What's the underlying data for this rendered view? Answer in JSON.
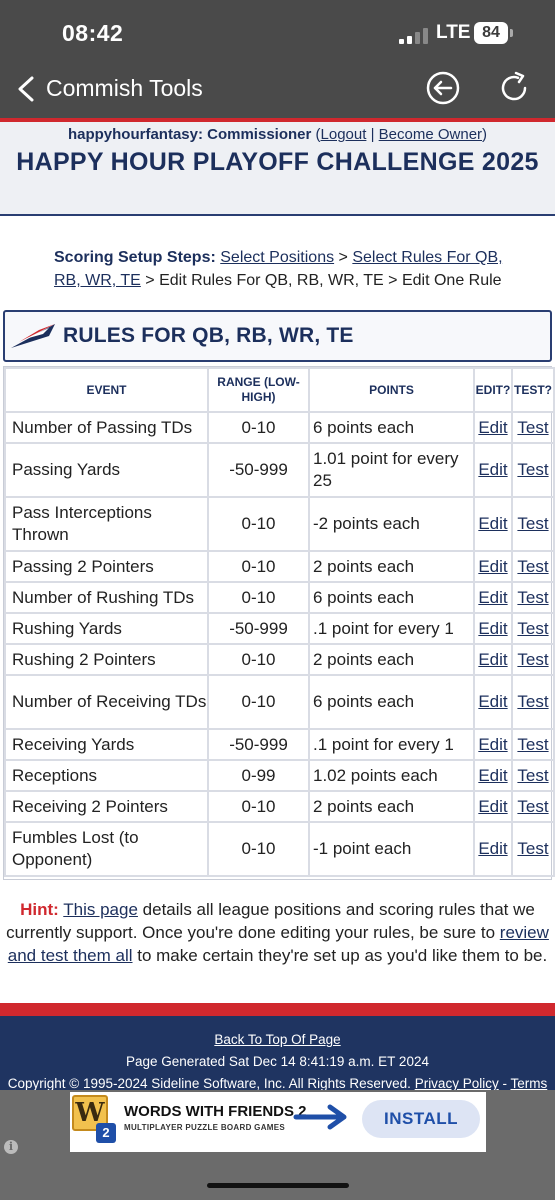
{
  "status_bar": {
    "time": "08:42",
    "network": "LTE",
    "battery": "84"
  },
  "nav": {
    "title": "Commish Tools",
    "back_icon": "chevron-left-icon",
    "back_button_icon": "circle-arrow-left-icon",
    "refresh_icon": "refresh-icon"
  },
  "header": {
    "user": "happyhourfantasy: Commissioner",
    "logout": "Logout",
    "separator": "|",
    "become_owner": "Become Owner",
    "league_title": "HAPPY HOUR PLAYOFF CHALLENGE 2025"
  },
  "steps": {
    "label": "Scoring Setup Steps:",
    "step1": "Select Positions",
    "sep": ">",
    "step2": "Select Rules For QB, RB, WR, TE",
    "step3": "Edit Rules For QB, RB, WR, TE",
    "step4": "Edit One Rule"
  },
  "section": {
    "title": "RULES FOR QB, RB, WR, TE"
  },
  "table": {
    "headers": {
      "event": "EVENT",
      "range": "RANGE (LOW-HIGH)",
      "points": "POINTS",
      "edit": "EDIT?",
      "test": "TEST?"
    },
    "rows": [
      {
        "event": "Number of Passing TDs",
        "range": "0-10",
        "points": "6 points each",
        "edit": "Edit",
        "test": "Test"
      },
      {
        "event": "Passing Yards",
        "range": "-50-999",
        "points": "1.01 point for every 25",
        "edit": "Edit",
        "test": "Test"
      },
      {
        "event": "Pass Interceptions Thrown",
        "range": "0-10",
        "points": "-2 points each",
        "edit": "Edit",
        "test": "Test"
      },
      {
        "event": "Passing 2 Pointers",
        "range": "0-10",
        "points": "2 points each",
        "edit": "Edit",
        "test": "Test"
      },
      {
        "event": "Number of Rushing TDs",
        "range": "0-10",
        "points": "6 points each",
        "edit": "Edit",
        "test": "Test"
      },
      {
        "event": "Rushing Yards",
        "range": "-50-999",
        "points": ".1 point for every 1",
        "edit": "Edit",
        "test": "Test"
      },
      {
        "event": "Rushing 2 Pointers",
        "range": "0-10",
        "points": "2 points each",
        "edit": "Edit",
        "test": "Test"
      },
      {
        "event": "Number of Receiving TDs",
        "range": "0-10",
        "points": "6 points each",
        "edit": "Edit",
        "test": "Test"
      },
      {
        "event": "Receiving Yards",
        "range": "-50-999",
        "points": ".1 point for every 1",
        "edit": "Edit",
        "test": "Test"
      },
      {
        "event": "Receptions",
        "range": "0-99",
        "points": "1.02 points each",
        "edit": "Edit",
        "test": "Test"
      },
      {
        "event": "Receiving 2 Pointers",
        "range": "0-10",
        "points": "2 points each",
        "edit": "Edit",
        "test": "Test"
      },
      {
        "event": "Fumbles Lost (to Opponent)",
        "range": "0-10",
        "points": "-1 point each",
        "edit": "Edit",
        "test": "Test"
      }
    ]
  },
  "hint": {
    "label": "Hint:",
    "link1": "This page",
    "text1": "details all league positions and scoring rules that we currently support. Once you're done editing your rules, be sure to",
    "link2": "review and test them all",
    "text2": "to make certain they're set up as you'd like them to be."
  },
  "footer": {
    "back_to_top": "Back To Top Of Page",
    "generated": "Page Generated Sat Dec 14 8:41:19 a.m. ET 2024",
    "copyright": "Copyright © 1995-2024 Sideline Software, Inc. All Rights Reserved.",
    "privacy": "Privacy Policy",
    "dash": "-",
    "terms": "Terms"
  },
  "ad": {
    "logo_letter": "W",
    "logo_num": "2",
    "name": "WORDS WITH FRIENDS 2",
    "subtitle": "MULTIPLAYER PUZZLE BOARD GAMES",
    "install": "INSTALL",
    "info": "i"
  },
  "colors": {
    "navy": "#1c2f5c",
    "red": "#d0282e",
    "footer_bg": "#1f3461",
    "nav_bg": "#4a4a4a"
  }
}
